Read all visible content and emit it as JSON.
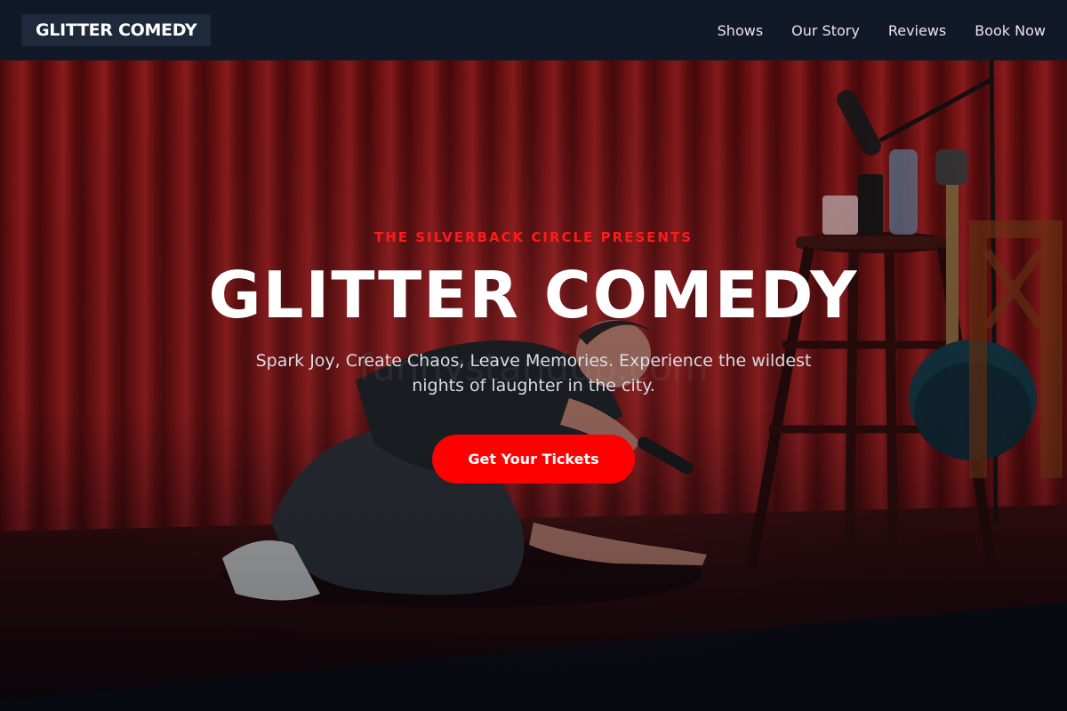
{
  "navbar": {
    "brand": "GLITTER COMEDY",
    "links": [
      {
        "label": "Shows"
      },
      {
        "label": "Our Story"
      },
      {
        "label": "Reviews"
      },
      {
        "label": "Book Now"
      }
    ]
  },
  "hero": {
    "eyebrow": "THE SILVERBACK CIRCLE PRESENTS",
    "title": "GLITTER COMEDY",
    "tagline": "Spark Joy, Create Chaos, Leave Memories. Experience the wildest nights of laughter in the city.",
    "cta_label": "Get Your Tickets",
    "background_image": "comedian-on-stage-photo"
  },
  "colors": {
    "nav_background": "#111827",
    "brand_background": "#1e293b",
    "accent": "#ff0000",
    "eyebrow": "#ff1a1a",
    "curtain": "#8a1414"
  }
}
